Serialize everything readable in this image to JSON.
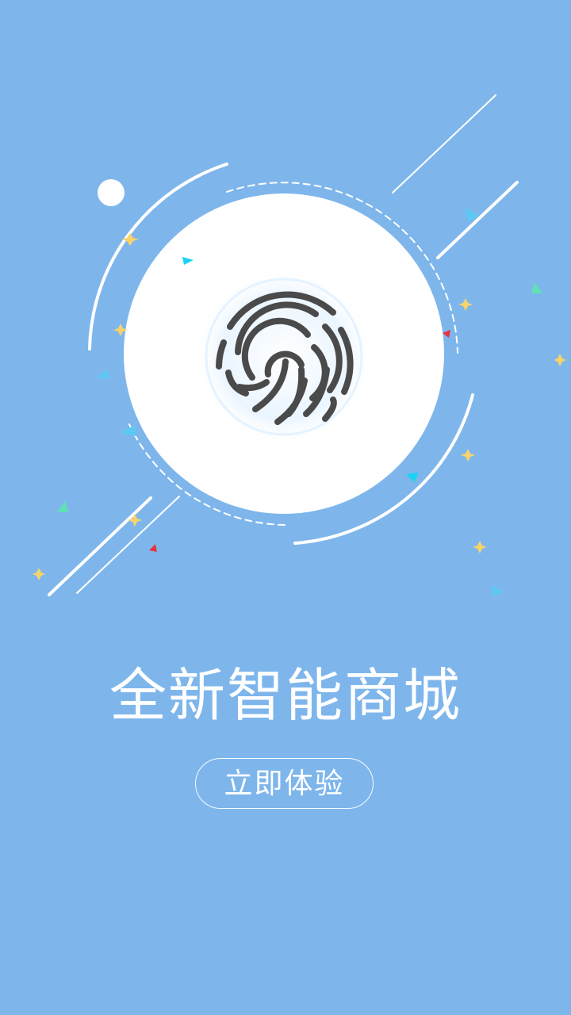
{
  "splash": {
    "title": "全新智能商城",
    "cta_label": "立即体验"
  },
  "colors": {
    "background": "#7eb6ec",
    "circle": "#ffffff",
    "fingerprint": "#4a4a4a",
    "confetti_yellow": "#f7d36b",
    "confetti_cyan": "#19d3f2",
    "confetti_green": "#5fe0b5",
    "confetti_red": "#e8323a",
    "confetti_sky": "#5cc9f5"
  },
  "icons": {
    "main": "fingerprint-icon"
  }
}
